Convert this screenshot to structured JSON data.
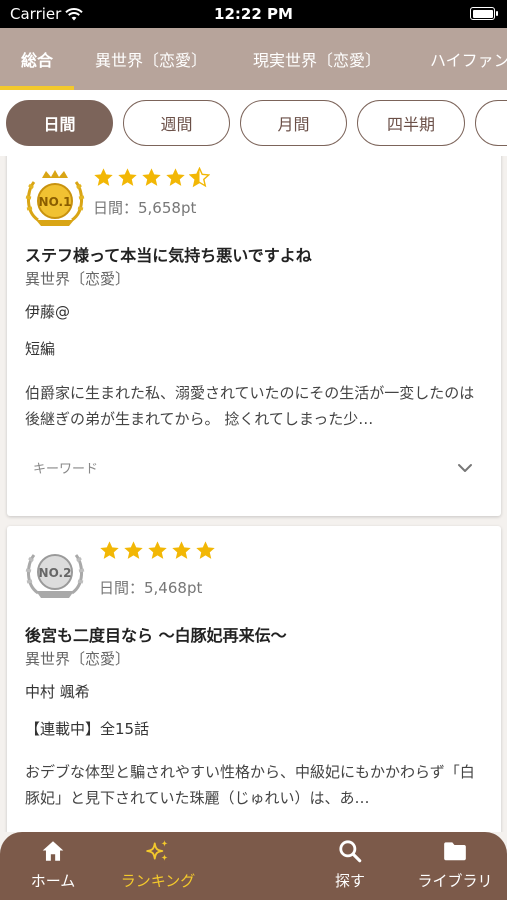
{
  "status_bar": {
    "carrier": "Carrier",
    "time": "12:22 PM"
  },
  "genre_tabs": [
    {
      "label": "総合",
      "active": true
    },
    {
      "label": "異世界〔恋愛〕",
      "active": false
    },
    {
      "label": "現実世界〔恋愛〕",
      "active": false
    },
    {
      "label": "ハイファン",
      "active": false
    }
  ],
  "periods": [
    {
      "label": "日間",
      "active": true
    },
    {
      "label": "週間",
      "active": false
    },
    {
      "label": "月間",
      "active": false
    },
    {
      "label": "四半期",
      "active": false
    },
    {
      "label": "",
      "active": false
    }
  ],
  "rankings": [
    {
      "rank_badge": "NO.1",
      "rating": 4.5,
      "points": "日間：5,658pt",
      "title": "ステフ様って本当に気持ち悪いですよね",
      "genre": "異世界〔恋愛〕",
      "author": "伊藤@",
      "format": "短編",
      "description": "伯爵家に生まれた私、溺愛されていたのにその生活が一変したのは後継ぎの弟が生まれてから。 捻くれてしまった少…",
      "keyword_label": "キーワード"
    },
    {
      "rank_badge": "NO.2",
      "rating": 5,
      "points": "日間：5,468pt",
      "title": "後宮も二度目なら 〜白豚妃再来伝〜",
      "genre": "異世界〔恋愛〕",
      "author": "中村 颯希",
      "format": "【連載中】全15話",
      "description": "おデブな体型と騙されやすい性格から、中級妃にもかかわらず「白豚妃」と見下されていた珠麗（じゅれい）は、あ…"
    }
  ],
  "bottom_nav": [
    {
      "label": "ホーム",
      "icon": "home-icon",
      "active": false
    },
    {
      "label": "ランキング",
      "icon": "sparkles-icon",
      "active": true
    },
    {
      "label": "探す",
      "icon": "search-icon",
      "active": false
    },
    {
      "label": "ライブラリ",
      "icon": "folder-icon",
      "active": false
    }
  ],
  "colors": {
    "accent": "#f3c92c",
    "brown": "#7c5a4a",
    "tab_bg": "#b7a49b"
  }
}
